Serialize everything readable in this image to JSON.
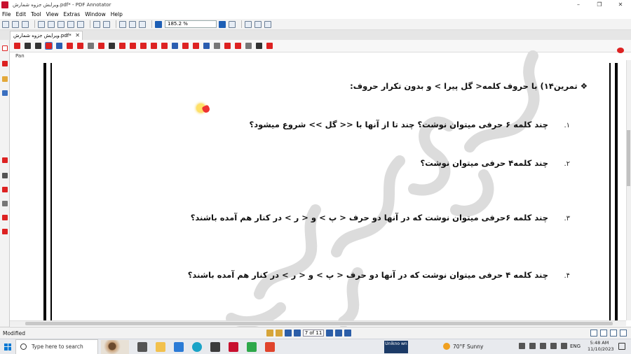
{
  "window": {
    "title": "ویرایش جزوه شمارش.pdf* - PDF Annotator",
    "controls": [
      "–",
      "❐",
      "✕"
    ]
  },
  "menu": [
    "File",
    "Edit",
    "Tool",
    "View",
    "Extras",
    "Window",
    "Help"
  ],
  "toolbar": {
    "zoom": "185.2 %"
  },
  "tab": {
    "label": "ویرایش جزوه شمارش.pdf*",
    "close": "✕"
  },
  "tool_label": "Pan",
  "document": {
    "heading": "تمرین۱۴) با حروف کلمه< گل پیرا > و بدون تکرار حروف:",
    "heading_bullet": "❖",
    "items": [
      {
        "num": "۱.",
        "text": "چند کلمه ۶ حرفی میتوان نوشت؟ چند تا از آنها با << گل >> شروع میشود؟"
      },
      {
        "num": "۲.",
        "text": "چند کلمه۴ حرفی میتوان نوشت؟"
      },
      {
        "num": "۳.",
        "text": "چند کلمه ۶حرفی میتوان نوشت که در آنها دو حرف < پ > و < ر > در کنار هم آمده باشند؟"
      },
      {
        "num": "۴.",
        "text": "چند کلمه ۴ حرفی میتوان نوشت که در آنها دو حرف < پ > و < ر > در کنار هم آمده باشند؟"
      }
    ],
    "watermark": "محمد صادق قنبری"
  },
  "status": {
    "text": "Modified",
    "page": "7 of 11"
  },
  "taskbar": {
    "search_placeholder": "Type here to search",
    "pinned_label": "Unikno wn",
    "weather": "70°F  Sunny",
    "language": "ENG",
    "time": "5:48 AM",
    "date": "11/10/2023"
  },
  "colors": {
    "accent": "#0078d4",
    "annot_red": "#d22222",
    "frame": "#000000"
  }
}
